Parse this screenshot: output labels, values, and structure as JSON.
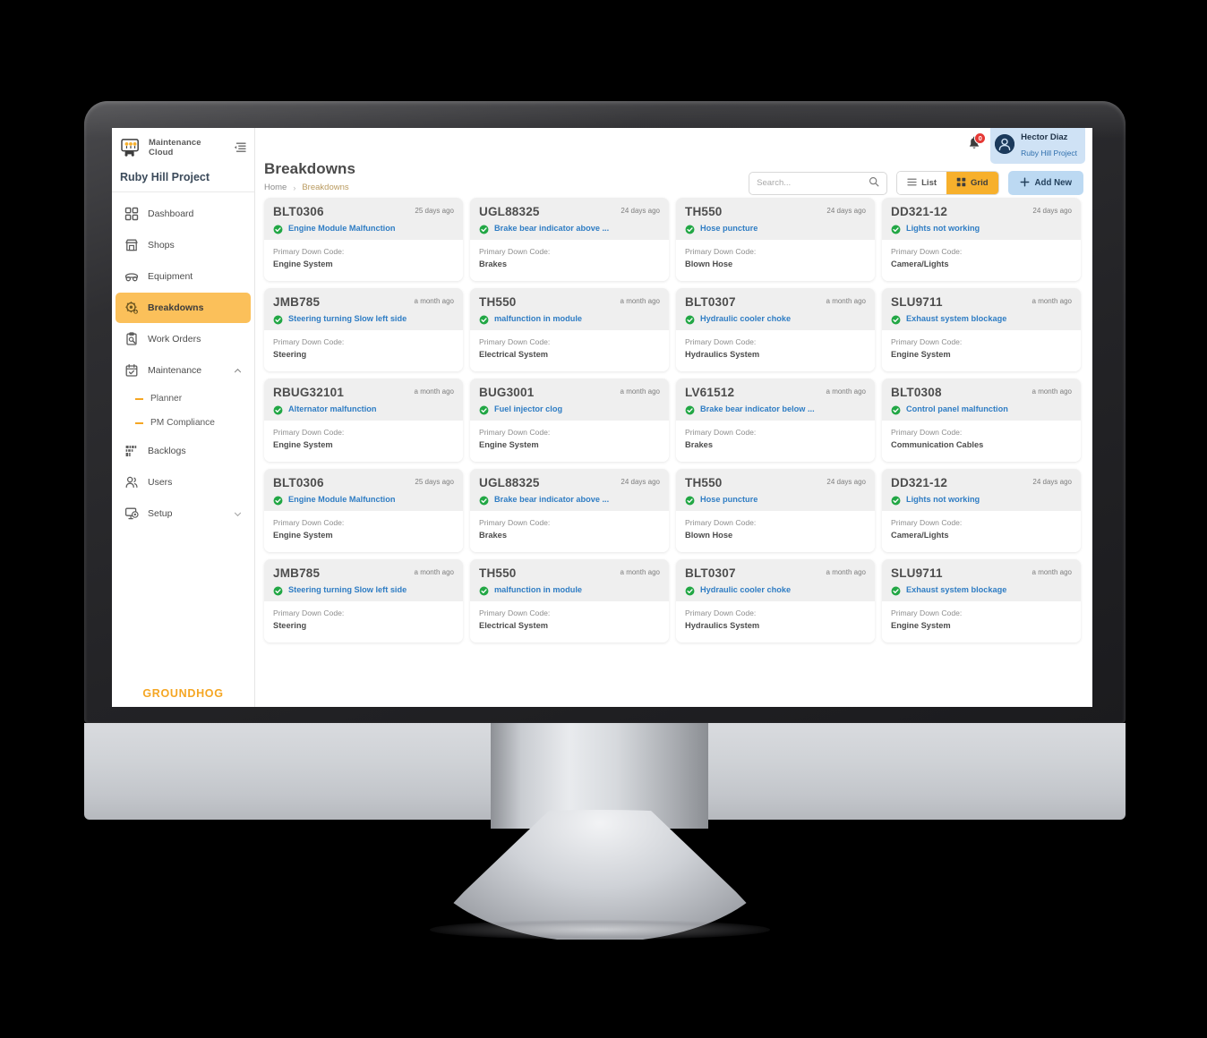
{
  "brand": {
    "name_line1": "Maintenance",
    "name_line2": "Cloud",
    "logo_icon": "maintenance-cloud-logo-icon",
    "collapse_icon": "collapse-sidebar-icon",
    "footer_logo": "GROUNDHOG"
  },
  "sidebar": {
    "project": "Ruby Hill Project",
    "items": [
      {
        "label": "Dashboard",
        "icon": "dashboard-icon",
        "active": false
      },
      {
        "label": "Shops",
        "icon": "shop-icon",
        "active": false
      },
      {
        "label": "Equipment",
        "icon": "equipment-icon",
        "active": false
      },
      {
        "label": "Breakdowns",
        "icon": "breakdown-icon",
        "active": true
      },
      {
        "label": "Work Orders",
        "icon": "work-order-icon",
        "active": false
      },
      {
        "label": "Maintenance",
        "icon": "calendar-icon",
        "active": false,
        "expanded": true,
        "chevron": "chevron-up-icon"
      },
      {
        "label": "Backlogs",
        "icon": "backlog-icon",
        "active": false
      },
      {
        "label": "Users",
        "icon": "users-icon",
        "active": false
      },
      {
        "label": "Setup",
        "icon": "setup-icon",
        "active": false,
        "chevron": "chevron-down-icon"
      }
    ],
    "maintenance_children": [
      {
        "label": "Planner"
      },
      {
        "label": "PM Compliance"
      }
    ]
  },
  "topbar": {
    "notification_count": "0",
    "bell_icon": "bell-icon",
    "user_name": "Hector Diaz",
    "user_project": "Ruby Hill Project",
    "avatar_icon": "user-avatar-icon"
  },
  "page": {
    "title": "Breakdowns",
    "breadcrumb_home": "Home",
    "breadcrumb_sep": "›",
    "breadcrumb_current": "Breakdowns"
  },
  "toolbar": {
    "search_placeholder": "Search...",
    "search_value": "",
    "search_icon": "search-icon",
    "list_label": "List",
    "list_icon": "list-view-icon",
    "grid_label": "Grid",
    "grid_icon": "grid-view-icon",
    "active_view": "Grid",
    "add_new_label": "Add New",
    "add_new_icon": "plus-icon"
  },
  "colors": {
    "accent_orange": "#f7b02c",
    "active_nav": "#fbc05a",
    "link_blue": "#2f7dc4",
    "add_new_bg": "#bcd9f2",
    "status_green": "#22a745",
    "badge_red": "#e53935",
    "card_head_bg": "#efefef",
    "groundhog_gold": "#f5a623"
  },
  "cards": [
    {
      "title": "BLT0306",
      "time": "25 days ago",
      "issue": "Engine Module Malfunction",
      "status_icon": "check-circle-icon",
      "label": "Primary Down Code:",
      "value": "Engine System"
    },
    {
      "title": "UGL88325",
      "time": "24 days ago",
      "issue": "Brake bear indicator above ...",
      "status_icon": "check-circle-icon",
      "label": "Primary Down Code:",
      "value": "Brakes"
    },
    {
      "title": "TH550",
      "time": "24 days ago",
      "issue": "Hose puncture",
      "status_icon": "check-circle-icon",
      "label": "Primary Down Code:",
      "value": "Blown Hose"
    },
    {
      "title": "DD321-12",
      "time": "24 days ago",
      "issue": "Lights not working",
      "status_icon": "check-circle-icon",
      "label": "Primary Down Code:",
      "value": "Camera/Lights"
    },
    {
      "title": "JMB785",
      "time": "a month ago",
      "issue": "Steering turning Slow left side",
      "status_icon": "check-circle-icon",
      "label": "Primary Down Code:",
      "value": "Steering"
    },
    {
      "title": "TH550",
      "time": "a month ago",
      "issue": "malfunction in module",
      "status_icon": "check-circle-icon",
      "label": "Primary Down Code:",
      "value": "Electrical System"
    },
    {
      "title": "BLT0307",
      "time": "a month ago",
      "issue": "Hydraulic cooler choke",
      "status_icon": "check-circle-icon",
      "label": "Primary Down Code:",
      "value": "Hydraulics System"
    },
    {
      "title": "SLU9711",
      "time": "a month ago",
      "issue": "Exhaust system blockage",
      "status_icon": "check-circle-icon",
      "label": "Primary Down Code:",
      "value": "Engine System"
    },
    {
      "title": "RBUG32101",
      "time": "a month ago",
      "issue": "Alternator malfunction",
      "status_icon": "check-circle-icon",
      "label": "Primary Down Code:",
      "value": "Engine System"
    },
    {
      "title": "BUG3001",
      "time": "a month ago",
      "issue": "Fuel injector clog",
      "status_icon": "check-circle-icon",
      "label": "Primary Down Code:",
      "value": "Engine System"
    },
    {
      "title": "LV61512",
      "time": "a month ago",
      "issue": "Brake bear indicator below ...",
      "status_icon": "check-circle-icon",
      "label": "Primary Down Code:",
      "value": "Brakes"
    },
    {
      "title": "BLT0308",
      "time": "a month ago",
      "issue": "Control panel malfunction",
      "status_icon": "check-circle-icon",
      "label": "Primary Down Code:",
      "value": "Communication\nCables"
    },
    {
      "title": "BLT0306",
      "time": "25 days ago",
      "issue": "Engine Module Malfunction",
      "status_icon": "check-circle-icon",
      "label": "Primary Down Code:",
      "value": "Engine System"
    },
    {
      "title": "UGL88325",
      "time": "24 days ago",
      "issue": "Brake bear indicator above ...",
      "status_icon": "check-circle-icon",
      "label": "Primary Down Code:",
      "value": "Brakes"
    },
    {
      "title": "TH550",
      "time": "24 days ago",
      "issue": "Hose puncture",
      "status_icon": "check-circle-icon",
      "label": "Primary Down Code:",
      "value": "Blown Hose"
    },
    {
      "title": "DD321-12",
      "time": "24 days ago",
      "issue": "Lights not working",
      "status_icon": "check-circle-icon",
      "label": "Primary Down Code:",
      "value": "Camera/Lights"
    },
    {
      "title": "JMB785",
      "time": "a month ago",
      "issue": "Steering turning Slow left side",
      "status_icon": "check-circle-icon",
      "label": "Primary Down Code:",
      "value": "Steering"
    },
    {
      "title": "TH550",
      "time": "a month ago",
      "issue": "malfunction in module",
      "status_icon": "check-circle-icon",
      "label": "Primary Down Code:",
      "value": "Electrical System"
    },
    {
      "title": "BLT0307",
      "time": "a month ago",
      "issue": "Hydraulic cooler choke",
      "status_icon": "check-circle-icon",
      "label": "Primary Down Code:",
      "value": "Hydraulics System"
    },
    {
      "title": "SLU9711",
      "time": "a month ago",
      "issue": "Exhaust system blockage",
      "status_icon": "check-circle-icon",
      "label": "Primary Down Code:",
      "value": "Engine System"
    }
  ]
}
